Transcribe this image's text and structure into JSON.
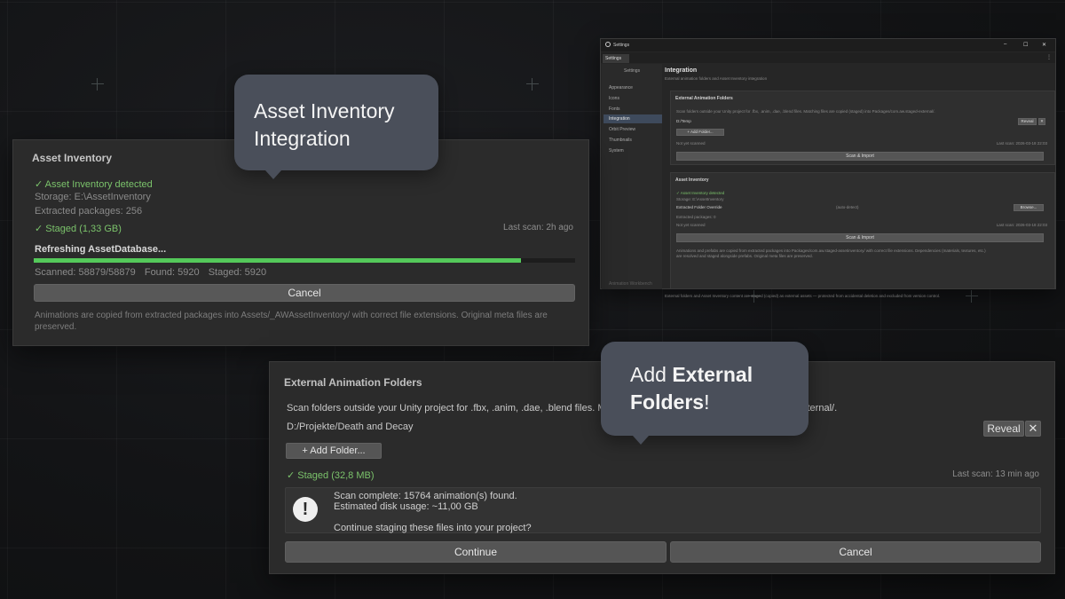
{
  "callouts": {
    "top_line1": "Asset Inventory",
    "top_line2": "Integration",
    "bottom_prefix": "Add ",
    "bottom_bold1": "External",
    "bottom_bold2": "Folders",
    "bottom_suffix": "!"
  },
  "asset_panel": {
    "title": "Asset Inventory",
    "detected": "✓ Asset Inventory detected",
    "storage": "Storage: E:\\AssetInventory",
    "extracted": "Extracted packages: 256",
    "staged": "✓ Staged (1,33 GB)",
    "last_scan": "Last scan: 2h ago",
    "refreshing": "Refreshing AssetDatabase...",
    "progress": 0.9,
    "scanned": "Scanned: 58879/58879",
    "found": "Found: 5920",
    "staged_count": "Staged: 5920",
    "cancel_label": "Cancel",
    "note": "Animations are copied from extracted packages into Assets/_AWAssetInventory/ with correct file extensions. Original meta files are preserved."
  },
  "external_panel": {
    "title": "External Animation Folders",
    "desc_left": "Scan folders outside your Unity project for .fbx, .anim, .dae, .blend files. Ma",
    "desc_right": "xternal/.",
    "folder_path": "D:/Projekte/Death and Decay",
    "reveal_label": "Reveal",
    "remove_label": "✕",
    "add_folder_label": "+ Add Folder...",
    "staged": "✓ Staged (32,8 MB)",
    "last_scan": "Last scan: 13 min ago",
    "help_line1": "Scan complete: 15764 animation(s) found.",
    "help_line2": "Estimated disk usage: ~11,00 GB",
    "help_line3": "Continue staging these files into your project?",
    "continue_label": "Continue",
    "cancel_label": "Cancel"
  },
  "settings_window": {
    "title": "Settings",
    "tab": "Settings",
    "sidebar_header": "Settings",
    "sidebar_items": [
      "Appearance",
      "Icons",
      "Fonts",
      "Integration",
      "Orbit Preview",
      "Thumbnails",
      "System"
    ],
    "sidebar_footer": "Animation Workbench",
    "heading": "Integration",
    "heading_sub": "External animation folders and Asset Inventory integration",
    "ext_title": "External Animation Folders",
    "ext_desc": "Scan folders outside your Unity project for .fbx, .anim, .dae, .blend files. Matching files are copied (staged) into Packages/com.aw.staged-external/.",
    "ext_path": "D:/Temp",
    "ext_reveal": "Reveal",
    "ext_x": "✕",
    "ext_add": "+ Add Folder...",
    "ext_status": "Not yet scanned",
    "ext_last": "Last scan: 2026-03-18 22:03",
    "ext_scan": "Scan & Import",
    "ai_title": "Asset Inventory",
    "ai_detected": "✓ Asset Inventory detected",
    "ai_storage": "Storage: E:\\AssetInventory",
    "ai_override": "Extracted Folder Override",
    "ai_override_val": "(auto-detect)",
    "ai_browse": "Browse...",
    "ai_extracted": "Extracted packages: 0",
    "ai_status": "Not yet scanned",
    "ai_last": "Last scan: 2026-03-18 22:03",
    "ai_scan": "Scan & Import",
    "ai_note1": "Animations and prefabs are copied from extracted packages into Packages/com.aw.staged-assetinventory/ with correct file extensions. Dependencies (materials, textures, etc.)",
    "ai_note2": "are resolved and staged alongside prefabs. Original meta files are preserved.",
    "footer": "External folders and Asset Inventory content are staged (copied) as external assets — protected from accidental deletion and excluded from version control."
  }
}
